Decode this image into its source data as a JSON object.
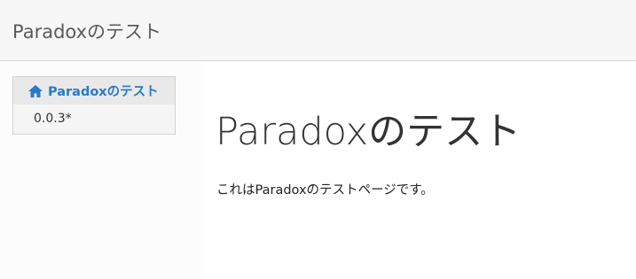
{
  "header": {
    "site_title": "Paradoxのテスト"
  },
  "sidebar": {
    "home_label": "Paradoxのテスト",
    "home_icon": "home-icon",
    "version": "0.0.3*"
  },
  "main": {
    "heading": "Paradoxのテスト",
    "body_text": "これはParadoxのテストページです。"
  },
  "colors": {
    "link": "#2a7ac6",
    "text": "#333333"
  }
}
